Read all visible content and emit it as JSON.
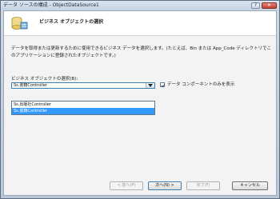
{
  "window": {
    "title": "データ ソースの構成 - ObjectDataSource1",
    "help_label": "?",
    "close_label": "✕"
  },
  "header": {
    "title": "ビジネス オブジェクトの選択"
  },
  "description": "データを取得または更新するために使用できるビジネス データを選択します。(たとえば、Bin または App_Code ディレクトリでこのアプリケーションに登録されたオブジェクトです。)",
  "business_object": {
    "label": "ビジネス オブジェクトの選択(B):",
    "selected": "Ss.書籍Controller",
    "options": [
      "Ss.出版社Controller",
      "Ss.書籍Controller"
    ],
    "highlighted_index": 1
  },
  "checkbox": {
    "label": "データ コンポーネントのみを表示",
    "checked": true
  },
  "buttons": {
    "prev": "< 前へ(P)",
    "next": "次へ(N) >",
    "finish": "完了(F)",
    "cancel": "キャンセル"
  },
  "colors": {
    "selection": "#3399ff",
    "focus_border": "#3c7fb1",
    "close_button": "#c4412f"
  }
}
